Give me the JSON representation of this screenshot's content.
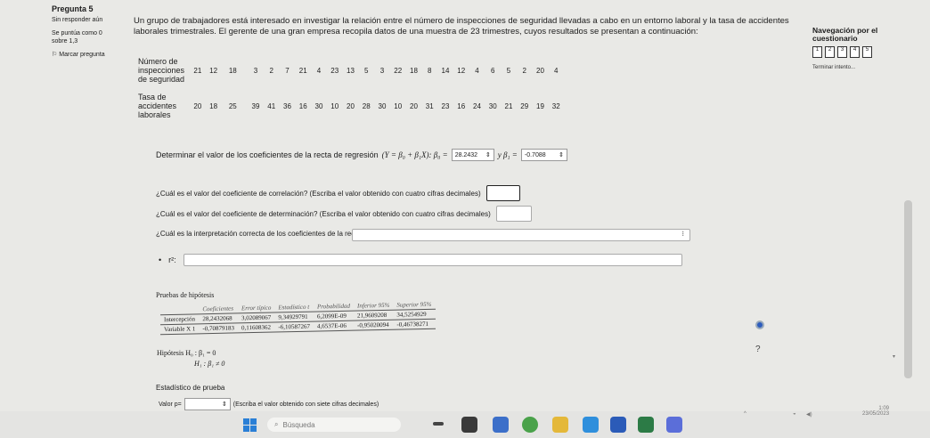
{
  "sidebar": {
    "question_title": "Pregunta 5",
    "status": "Sin responder aún",
    "score_text": "Se puntúa como 0 sobre 1,3",
    "flag_label": "Marcar pregunta"
  },
  "question": {
    "intro_line1": "Un grupo de trabajadores está interesado en investigar la relación entre el número de inspecciones de seguridad llevadas a cabo en un entorno laboral y la tasa de accidentes",
    "intro_line2": "laborales trimestrales. El gerente de una gran empresa recopila datos de una muestra de 23 trimestres, cuyos resultados se presentan a continuación:",
    "row1_label_a": "Número de",
    "row1_label_b": "inspecciones",
    "row1_label_c": "de seguridad",
    "row1_values": [
      "21",
      "12",
      "18",
      "3",
      "2",
      "7",
      "21",
      "4",
      "23",
      "13",
      "5",
      "3",
      "22",
      "18",
      "8",
      "14",
      "12",
      "4",
      "6",
      "5",
      "2",
      "20",
      "4"
    ],
    "row2_label_a": "Tasa de",
    "row2_label_b": "accidentes",
    "row2_label_c": "laborales",
    "row2_values": [
      "20",
      "18",
      "25",
      "39",
      "41",
      "36",
      "16",
      "30",
      "10",
      "20",
      "28",
      "30",
      "10",
      "20",
      "31",
      "23",
      "16",
      "24",
      "30",
      "21",
      "29",
      "19",
      "32"
    ],
    "q1_text": "Determinar el valor de los coeficientes de la recta de regresión",
    "q1_formula": "(Y = β₀ + β₁X): β₀ =",
    "q1_b0_value": "28.2432",
    "q1_b1_text": "y β₁ =",
    "q1_b1_value": "-0.7088",
    "q2_text": "¿Cuál es el valor del coeficiente de correlación? (Escriba el valor obtenido con cuatro cifras decimales)",
    "q3_text": "¿Cuál es el valor del coeficiente de determinación? (Escriba el valor obtenido con cuatro cifras decimales)",
    "q4_text": "¿Cuál es la interpretación correcta de los coeficientes de la recta de regresión?",
    "r2_label": "r²:"
  },
  "hypothesis": {
    "title": "Pruebas de hipótesis",
    "headers": [
      "",
      "Coeficientes",
      "Error típico",
      "Estadístico t",
      "Probabilidad",
      "Inferior 95%",
      "Superior 95%"
    ],
    "rows": [
      [
        "Intercepción",
        "28,2432068",
        "3,02089067",
        "9,34929791",
        "6,2099E-09",
        "21,9609208",
        "34,5254929"
      ],
      [
        "Variable X 1",
        "-0,70879183",
        "0,11608362",
        "-6,10587267",
        "4,6537E-06",
        "-0,95020094",
        "-0,46738271"
      ]
    ],
    "h0": "Hipótesis H₀ : β₁ = 0",
    "h1": "H₁ : β₁ ≠ 0",
    "stat_label": "Estadístico de prueba",
    "pvalue_label": "Valor p=",
    "pvalue_hint": "(Escriba el valor obtenido con siete cifras decimales)"
  },
  "navigation": {
    "title": "Navegación por el cuestionario",
    "buttons": [
      "1",
      "2",
      "3",
      "4",
      "5"
    ],
    "finish_link": "Terminar intento..."
  },
  "taskbar": {
    "search_placeholder": "Búsqueda",
    "time": "1:09",
    "date": "23/05/2023"
  }
}
